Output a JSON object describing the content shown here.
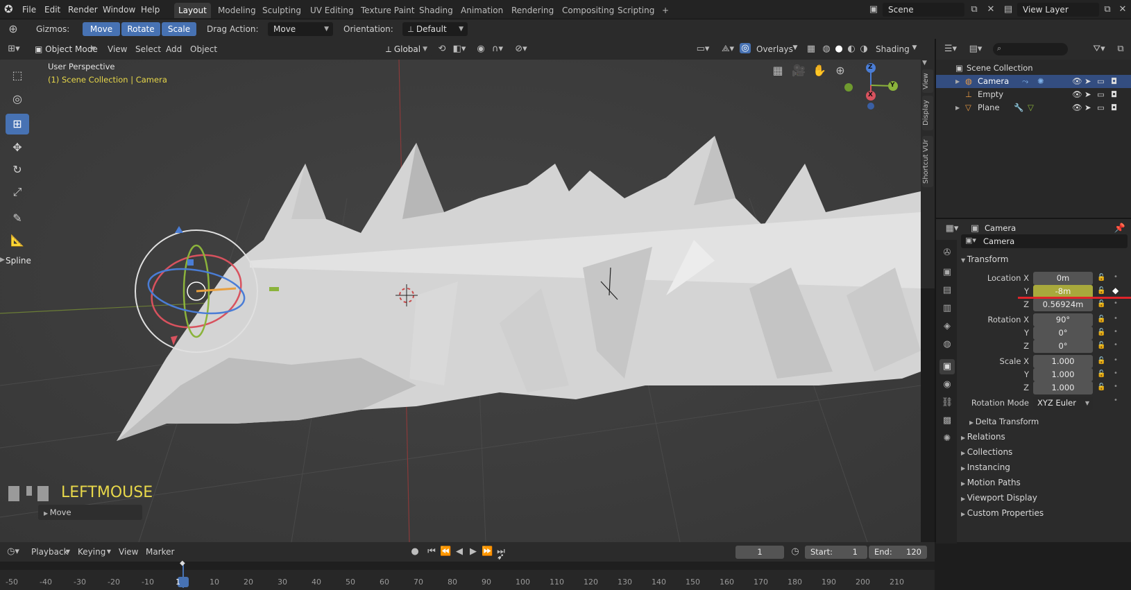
{
  "topbar": {
    "menus": [
      "File",
      "Edit",
      "Render",
      "Window",
      "Help"
    ],
    "workspaces": [
      "Layout",
      "Modeling",
      "Sculpting",
      "UV Editing",
      "Texture Paint",
      "Shading",
      "Animation",
      "Rendering",
      "Compositing",
      "Scripting"
    ],
    "plus": "+",
    "scene_value": "Scene",
    "viewlayer_value": "View Layer"
  },
  "tool_header": {
    "gizmos_label": "Gizmos:",
    "move": "Move",
    "rotate": "Rotate",
    "scale": "Scale",
    "drag_label": "Drag Action:",
    "drag_value": "Move",
    "orient_label": "Orientation:",
    "orient_value": "Default"
  },
  "viewport_header": {
    "mode": "Object Mode",
    "menus": [
      "View",
      "Select",
      "Add",
      "Object"
    ],
    "transform_space": "Global",
    "overlays": "Overlays",
    "shading": "Shading"
  },
  "viewport": {
    "perspective": "User Perspective",
    "collection_info": "(1) Scene Collection | Camera",
    "spline_label": "Spline",
    "key_display": "LEFTMOUSE",
    "last_op": "Move",
    "axes": {
      "x": "X",
      "y": "Y",
      "z": "Z"
    }
  },
  "side_tabs": [
    "View",
    "Display",
    "Shortcut VUr"
  ],
  "outliner": {
    "root": "Scene Collection",
    "items": [
      {
        "name": "Camera",
        "selected": true
      },
      {
        "name": "Empty",
        "selected": false
      },
      {
        "name": "Plane",
        "selected": false
      }
    ]
  },
  "properties": {
    "object_name": "Camera",
    "data_name": "Camera",
    "transform_title": "Transform",
    "location_label": "Location X",
    "loc_x": "0m",
    "loc_y": "-8m",
    "loc_z": "0.56924m",
    "rotation_label": "Rotation X",
    "rot_x": "90°",
    "rot_y": "0°",
    "rot_z": "0°",
    "scale_label": "Scale X",
    "scale_x": "1.000",
    "scale_y": "1.000",
    "scale_z": "1.000",
    "y_label": "Y",
    "z_label": "Z",
    "rotation_mode_label": "Rotation Mode",
    "rotation_mode_value": "XYZ Euler",
    "delta": "Delta Transform",
    "sections": [
      "Relations",
      "Collections",
      "Instancing",
      "Motion Paths",
      "Viewport Display",
      "Custom Properties"
    ],
    "highlight_color": "#a8a93c",
    "annotation_color": "#e0242a"
  },
  "timeline": {
    "menus": [
      "Playback",
      "Keying",
      "View",
      "Marker"
    ],
    "current_frame": "1",
    "start_label": "Start:",
    "start_value": "1",
    "end_label": "End:",
    "end_value": "120",
    "ticks": [
      "-50",
      "-40",
      "-30",
      "-20",
      "-10",
      "1",
      "10",
      "20",
      "30",
      "40",
      "50",
      "60",
      "70",
      "80",
      "90",
      "100",
      "110",
      "120",
      "130",
      "140",
      "150",
      "160",
      "170",
      "180",
      "190",
      "200",
      "210"
    ]
  },
  "colors": {
    "accent": "#4772b3",
    "selected_row": "#334d80",
    "highlight_text": "#e8d84a"
  }
}
